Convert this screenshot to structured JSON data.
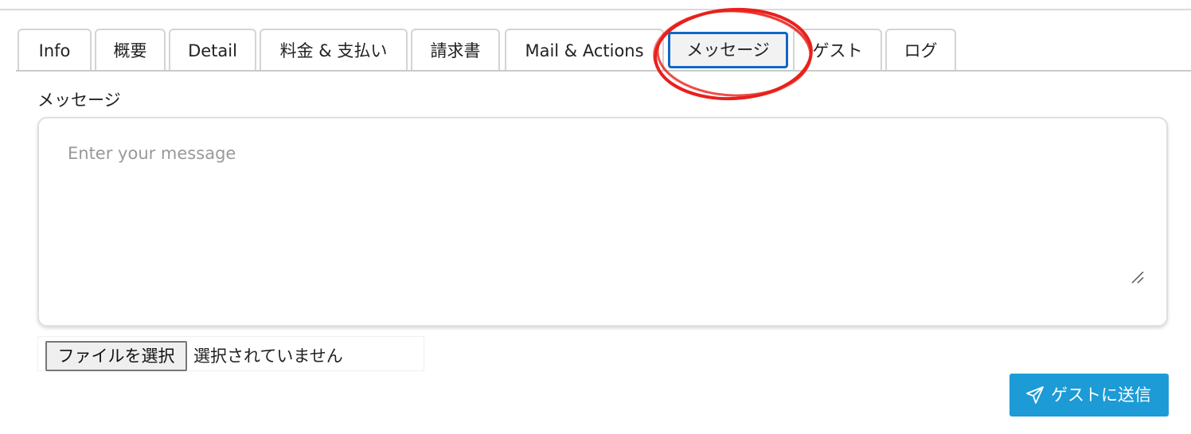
{
  "tabs": [
    {
      "label": "Info"
    },
    {
      "label": "概要"
    },
    {
      "label": "Detail"
    },
    {
      "label": "料金 & 支払い"
    },
    {
      "label": "請求書"
    },
    {
      "label": "Mail & Actions"
    },
    {
      "label": "メッセージ",
      "active": true
    },
    {
      "label": "ゲスト"
    },
    {
      "label": "ログ"
    }
  ],
  "message": {
    "label": "メッセージ",
    "placeholder": "Enter your message",
    "value": ""
  },
  "file_input": {
    "button_label": "ファイルを選択",
    "status": "選択されていません"
  },
  "send_button": {
    "label": "ゲストに送信",
    "icon": "paper-plane-icon",
    "color": "#1d9bd6"
  },
  "colors": {
    "active_tab_border": "#1167c8",
    "annotation": "#e8211c"
  }
}
